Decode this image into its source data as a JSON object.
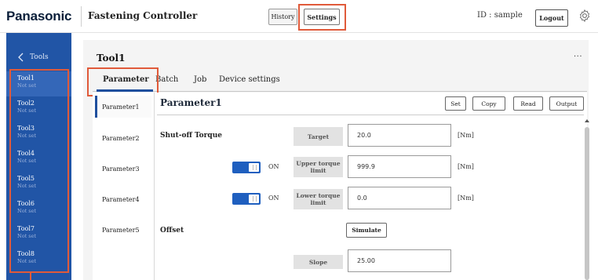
{
  "brand": "Panasonic",
  "app_title": "Fastening Controller",
  "header": {
    "history_label": "History",
    "settings_label": "Settings",
    "user_id": "ID : sample",
    "logout_label": "Logout"
  },
  "sidebar": {
    "back_label": "Tools",
    "tools": [
      {
        "name": "Tool1",
        "status": "Not set"
      },
      {
        "name": "Tool2",
        "status": "Not set"
      },
      {
        "name": "Tool3",
        "status": "Not set"
      },
      {
        "name": "Tool4",
        "status": "Not set"
      },
      {
        "name": "Tool5",
        "status": "Not set"
      },
      {
        "name": "Tool6",
        "status": "Not set"
      },
      {
        "name": "Tool7",
        "status": "Not set"
      },
      {
        "name": "Tool8",
        "status": "Not set"
      }
    ]
  },
  "main": {
    "tool_title": "Tool1",
    "more_label": "...",
    "tabs": [
      "Parameter",
      "Batch",
      "Job",
      "Device settings"
    ],
    "parameters": [
      "Parameter1",
      "Parameter2",
      "Parameter3",
      "Parameter4",
      "Parameter5"
    ],
    "param_title": "Parameter1",
    "actions": {
      "set": "Set",
      "copy": "Copy",
      "read": "Read",
      "output": "Output"
    }
  },
  "form": {
    "shutoff_label": "Shut-off Torque",
    "target_label": "Target",
    "target_value": "20.0",
    "upper_label": "Upper torque limit",
    "upper_value": "999.9",
    "lower_label": "Lower torque limit",
    "lower_value": "0.0",
    "unit": "[Nm]",
    "toggle_on": "ON",
    "offset_label": "Offset",
    "simulate_label": "Simulate",
    "slope_label": "Slope",
    "slope_value": "25.00"
  },
  "colors": {
    "sidebar_bg": "#2155a6",
    "accent": "#1f5fbf",
    "highlight": "#e05a3a"
  }
}
